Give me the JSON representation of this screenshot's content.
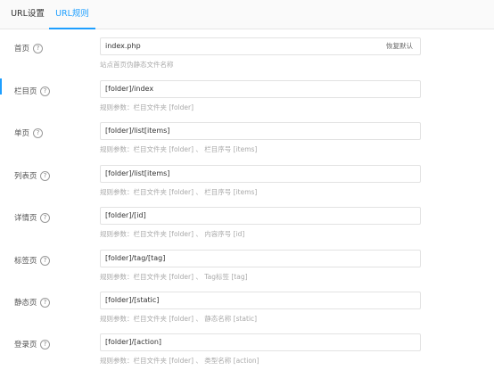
{
  "tabs": [
    {
      "label": "URL设置"
    },
    {
      "label": "URL规则",
      "active": true
    }
  ],
  "colors": {
    "accent": "#1e9fff",
    "text": "#333333",
    "hint": "#aaaaaa",
    "border": "#e2e2e2"
  },
  "help_icon_glyph": "?",
  "rows": [
    {
      "label": "首页",
      "value": "index.php",
      "action": "恢复默认",
      "hint": "站点首页伪静态文件名称"
    },
    {
      "label": "栏目页",
      "value": "[folder]/index",
      "hint": "规则参数：栏目文件夹 [folder]"
    },
    {
      "label": "单页",
      "value": "[folder]/list[items]",
      "hint": "规则参数：栏目文件夹 [folder] 、 栏目序号 [items]"
    },
    {
      "label": "列表页",
      "value": "[folder]/list[items]",
      "hint": "规则参数：栏目文件夹 [folder] 、 栏目序号 [items]"
    },
    {
      "label": "详情页",
      "value": "[folder]/[id]",
      "hint": "规则参数：栏目文件夹 [folder] 、 内容序号 [id]"
    },
    {
      "label": "标签页",
      "value": "[folder]/tag/[tag]",
      "hint": "规则参数：栏目文件夹 [folder] 、 Tag标签 [tag]"
    },
    {
      "label": "静态页",
      "value": "[folder]/[static]",
      "hint": "规则参数：栏目文件夹 [folder] 、 静态名称 [static]"
    },
    {
      "label": "登录页",
      "value": "[folder]/[action]",
      "hint": "规则参数：栏目文件夹 [folder] 、 类型名称 [action]"
    }
  ]
}
